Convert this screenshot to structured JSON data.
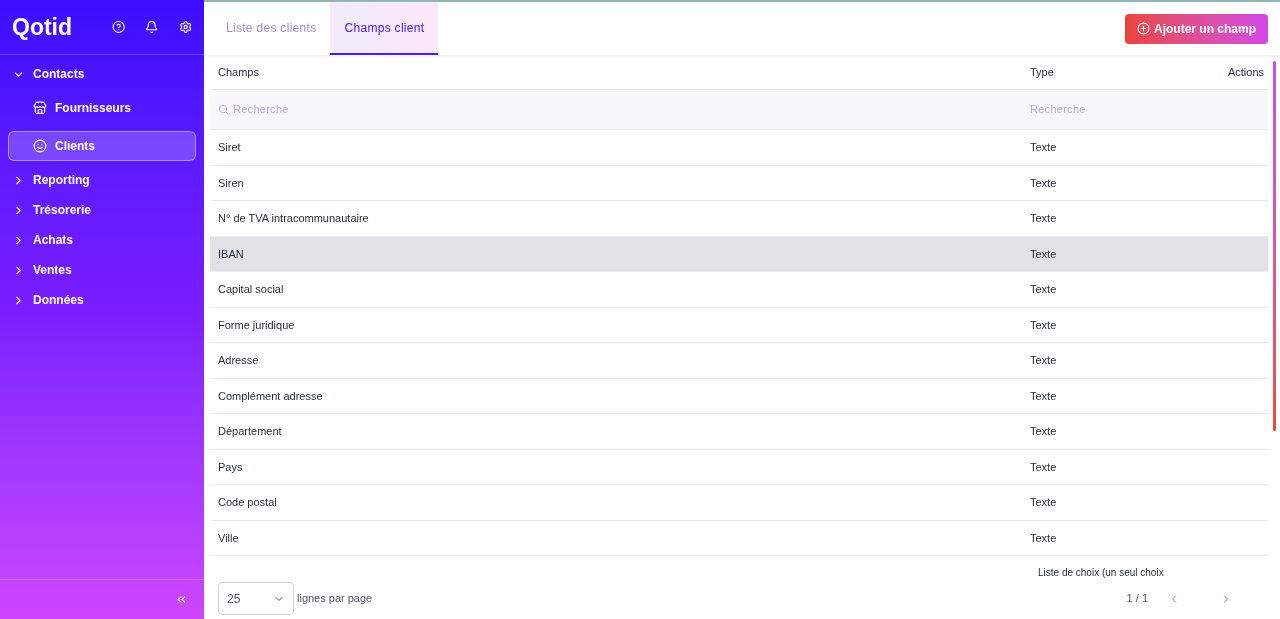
{
  "brand": "Qotid",
  "nav": [
    {
      "label": "Contacts",
      "expanded": true,
      "children": [
        {
          "label": "Fournisseurs",
          "kind": "store",
          "selected": false
        },
        {
          "label": "Clients",
          "kind": "face",
          "selected": true
        }
      ]
    },
    {
      "label": "Reporting",
      "expanded": false
    },
    {
      "label": "Trésorerie",
      "expanded": false
    },
    {
      "label": "Achats",
      "expanded": false
    },
    {
      "label": "Ventes",
      "expanded": false
    },
    {
      "label": "Données",
      "expanded": false
    }
  ],
  "tabs": [
    {
      "label": "Liste des clients",
      "selected": false
    },
    {
      "label": "Champs client",
      "selected": true
    }
  ],
  "add_button": "Ajouter un champ",
  "table": {
    "columns": [
      "Champs",
      "Type",
      "Actions"
    ],
    "search_placeholders": [
      "Recherche",
      "Recherche"
    ],
    "rows": [
      {
        "field": "Siret",
        "type": "Texte",
        "selected": false
      },
      {
        "field": "Siren",
        "type": "Texte",
        "selected": false
      },
      {
        "field": "N° de TVA intracommunautaire",
        "type": "Texte",
        "selected": false
      },
      {
        "field": "IBAN",
        "type": "Texte",
        "selected": true
      },
      {
        "field": "Capital social",
        "type": "Texte",
        "selected": false
      },
      {
        "field": "Forme juridique",
        "type": "Texte",
        "selected": false
      },
      {
        "field": "Adresse",
        "type": "Texte",
        "selected": false
      },
      {
        "field": "Complément adresse",
        "type": "Texte",
        "selected": false
      },
      {
        "field": "Département",
        "type": "Texte",
        "selected": false
      },
      {
        "field": "Pays",
        "type": "Texte",
        "selected": false
      },
      {
        "field": "Code postal",
        "type": "Texte",
        "selected": false
      },
      {
        "field": "Ville",
        "type": "Texte",
        "selected": false
      }
    ],
    "partial_row_type": "Liste de choix (un seul choix"
  },
  "pagination": {
    "page_size": "25",
    "page_size_label": "lignes par page",
    "page": "1 / 1"
  }
}
